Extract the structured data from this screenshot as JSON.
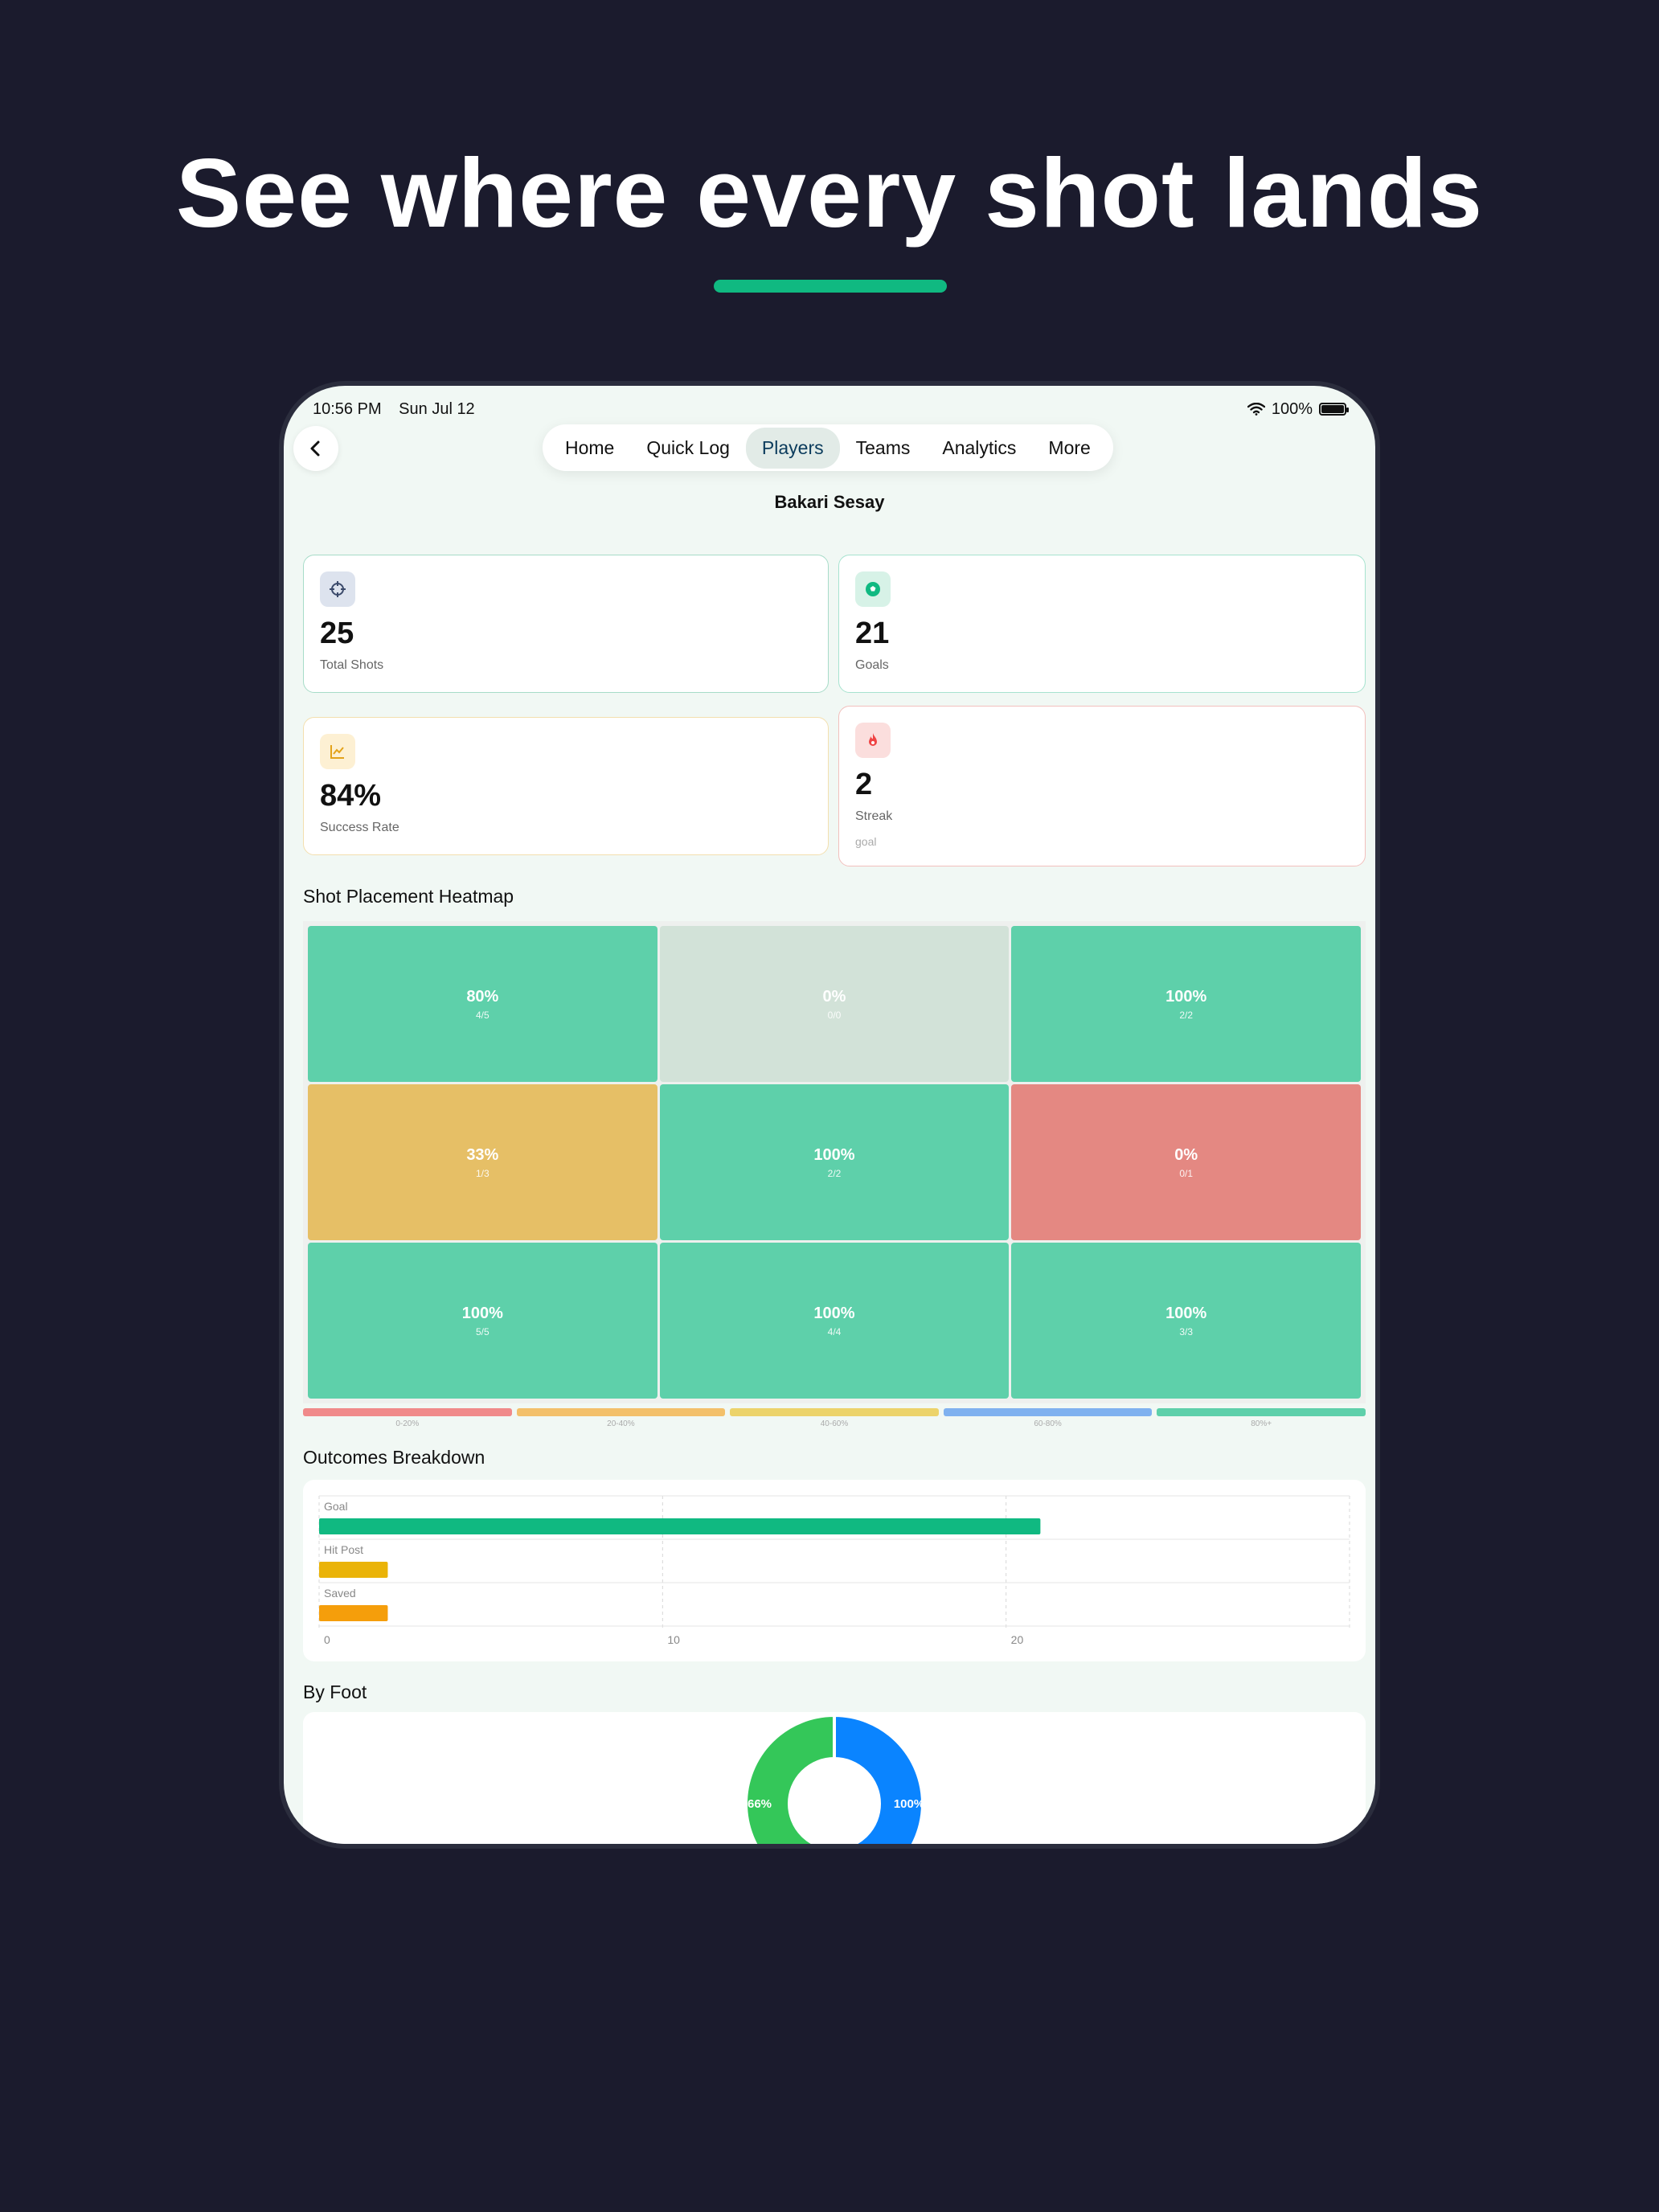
{
  "headline": "See where every shot lands",
  "colors": {
    "accent": "#10b981",
    "background": "#1b1b2d"
  },
  "status_bar": {
    "time": "10:56 PM",
    "date": "Sun Jul 12",
    "battery": "100%"
  },
  "nav": {
    "back_icon": "chevron-left-icon",
    "tabs": [
      {
        "label": "Home",
        "active": false
      },
      {
        "label": "Quick Log",
        "active": false
      },
      {
        "label": "Players",
        "active": true
      },
      {
        "label": "Teams",
        "active": false
      },
      {
        "label": "Analytics",
        "active": false
      },
      {
        "label": "More",
        "active": false
      }
    ]
  },
  "player_name": "Bakari Sesay",
  "stats": {
    "total_shots": {
      "value": "25",
      "label": "Total Shots",
      "icon": "crosshair-icon"
    },
    "goals": {
      "value": "21",
      "label": "Goals",
      "icon": "soccer-ball-icon"
    },
    "success_rate": {
      "value": "84%",
      "label": "Success Rate",
      "icon": "trend-up-icon"
    },
    "streak": {
      "value": "2",
      "label": "Streak",
      "sub": "goal",
      "icon": "flame-icon"
    }
  },
  "heatmap": {
    "title": "Shot Placement Heatmap",
    "cells": [
      {
        "pct": "80%",
        "count": "4/5",
        "color": "#5ed0aa"
      },
      {
        "pct": "0%",
        "count": "0/0",
        "color": "#d2e2d8"
      },
      {
        "pct": "100%",
        "count": "2/2",
        "color": "#5ed0aa"
      },
      {
        "pct": "33%",
        "count": "1/3",
        "color": "#e6bf66"
      },
      {
        "pct": "100%",
        "count": "2/2",
        "color": "#5ed0aa"
      },
      {
        "pct": "0%",
        "count": "0/1",
        "color": "#e48882"
      },
      {
        "pct": "100%",
        "count": "5/5",
        "color": "#5ed0aa"
      },
      {
        "pct": "100%",
        "count": "4/4",
        "color": "#5ed0aa"
      },
      {
        "pct": "100%",
        "count": "3/3",
        "color": "#5ed0aa"
      }
    ],
    "legend": [
      {
        "label": "0-20%",
        "color": "#f08a8a"
      },
      {
        "label": "20-40%",
        "color": "#f3c06a"
      },
      {
        "label": "40-60%",
        "color": "#ecd36a"
      },
      {
        "label": "60-80%",
        "color": "#7fb1ef"
      },
      {
        "label": "80%+",
        "color": "#5ed0aa"
      }
    ]
  },
  "outcomes": {
    "title": "Outcomes Breakdown",
    "chart_data": {
      "type": "bar",
      "orientation": "horizontal",
      "categories": [
        "Goal",
        "Hit Post",
        "Saved"
      ],
      "values": [
        21,
        2,
        2
      ],
      "colors": [
        "#10b981",
        "#eab308",
        "#f59e0b"
      ],
      "xlim": [
        0,
        30
      ],
      "xticks": [
        "0",
        "10",
        "20"
      ],
      "grid": true
    }
  },
  "by_foot": {
    "title": "By Foot",
    "chart_data": {
      "type": "pie",
      "donut": true,
      "labels": [
        "66%",
        "100%"
      ],
      "values": [
        50,
        50
      ],
      "colors": [
        "#34c759",
        "#0a84ff"
      ]
    }
  }
}
